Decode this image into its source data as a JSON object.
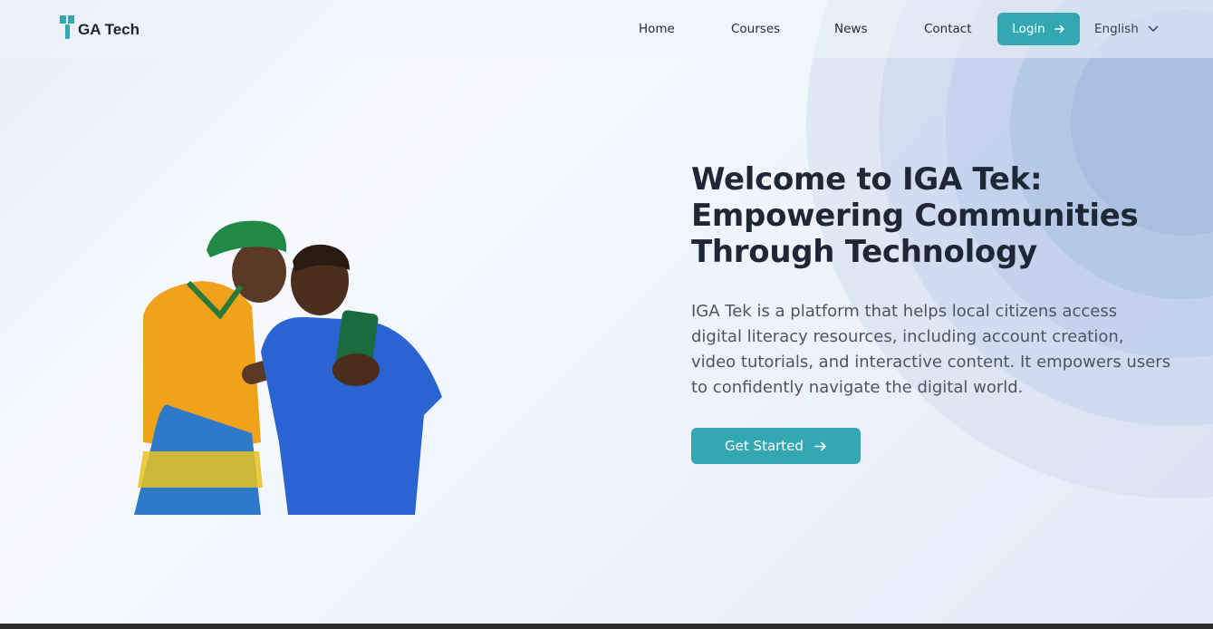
{
  "brand": {
    "name": "GA Tech",
    "accent": "#34a8b2"
  },
  "nav": {
    "links": [
      {
        "label": "Home"
      },
      {
        "label": "Courses"
      },
      {
        "label": "News"
      },
      {
        "label": "Contact"
      }
    ],
    "login_label": "Login",
    "login_icon": "arrow-right-icon",
    "language": "English",
    "language_icon": "chevron-down-icon"
  },
  "hero": {
    "title": "Welcome to IGA Tek: Empowering Communities Through Technology",
    "description": "IGA Tek is a platform that helps local citizens access digital literacy resources, including account creation, video tutorials, and interactive content. It empowers users to confidently navigate the digital world.",
    "cta_label": "Get Started",
    "cta_icon": "arrow-right-icon"
  }
}
